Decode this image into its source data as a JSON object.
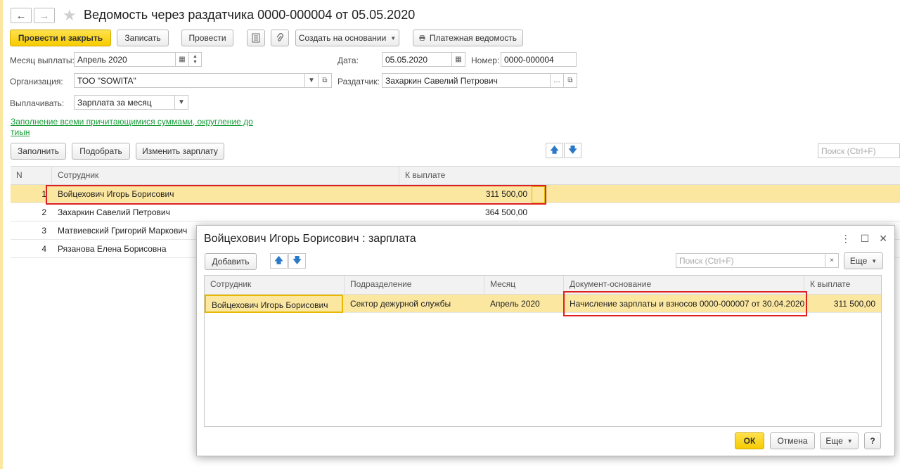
{
  "window": {
    "title": "Ведомость через раздатчика 0000-000004 от 05.05.2020",
    "back_icon": "←",
    "forward_icon": "→",
    "star_icon": "★"
  },
  "toolbar": {
    "post_close": "Провести и закрыть",
    "save": "Записать",
    "post": "Провести",
    "create_based": "Создать на основании",
    "payment_sheet": "Платежная ведомость"
  },
  "form": {
    "month_label": "Месяц выплаты:",
    "month_value": "Апрель 2020",
    "date_label": "Дата:",
    "date_value": "05.05.2020",
    "number_label": "Номер:",
    "number_value": "0000-000004",
    "org_label": "Организация:",
    "org_value": "ТОО \"SOWITA\"",
    "distributor_label": "Раздатчик:",
    "distributor_value": "Захаркин Савелий Петрович",
    "pay_label": "Выплачивать:",
    "pay_value": "Зарплата за месяц",
    "fill_link": "Заполнение всеми причитающимися суммами, округление до тиын"
  },
  "table_toolbar": {
    "fill": "Заполнить",
    "pick": "Подобрать",
    "change_salary": "Изменить зарплату",
    "search_placeholder": "Поиск (Ctrl+F)"
  },
  "table": {
    "headers": [
      "N",
      "Сотрудник",
      "К выплате"
    ],
    "rows": [
      {
        "n": "1",
        "employee": "Войцехович Игорь Борисович",
        "amount": "311 500,00"
      },
      {
        "n": "2",
        "employee": "Захаркин Савелий Петрович",
        "amount": "364 500,00"
      },
      {
        "n": "3",
        "employee": "Матвиевский Григорий Маркович",
        "amount": ""
      },
      {
        "n": "4",
        "employee": "Рязанова Елена Борисовна",
        "amount": ""
      }
    ]
  },
  "dialog": {
    "title": "Войцехович Игорь Борисович : зарплата",
    "add": "Добавить",
    "search_placeholder": "Поиск (Ctrl+F)",
    "more": "Еще",
    "headers": [
      "Сотрудник",
      "Подразделение",
      "Месяц",
      "Документ-основание",
      "К выплате"
    ],
    "row": {
      "employee": "Войцехович Игорь Борисович",
      "department": "Сектор дежурной службы",
      "month": "Апрель 2020",
      "document": "Начисление зарплаты и взносов 0000-000007 от 30.04.2020",
      "amount": "311 500,00"
    },
    "ok": "ОК",
    "cancel": "Отмена",
    "more2": "Еще",
    "help": "?"
  }
}
